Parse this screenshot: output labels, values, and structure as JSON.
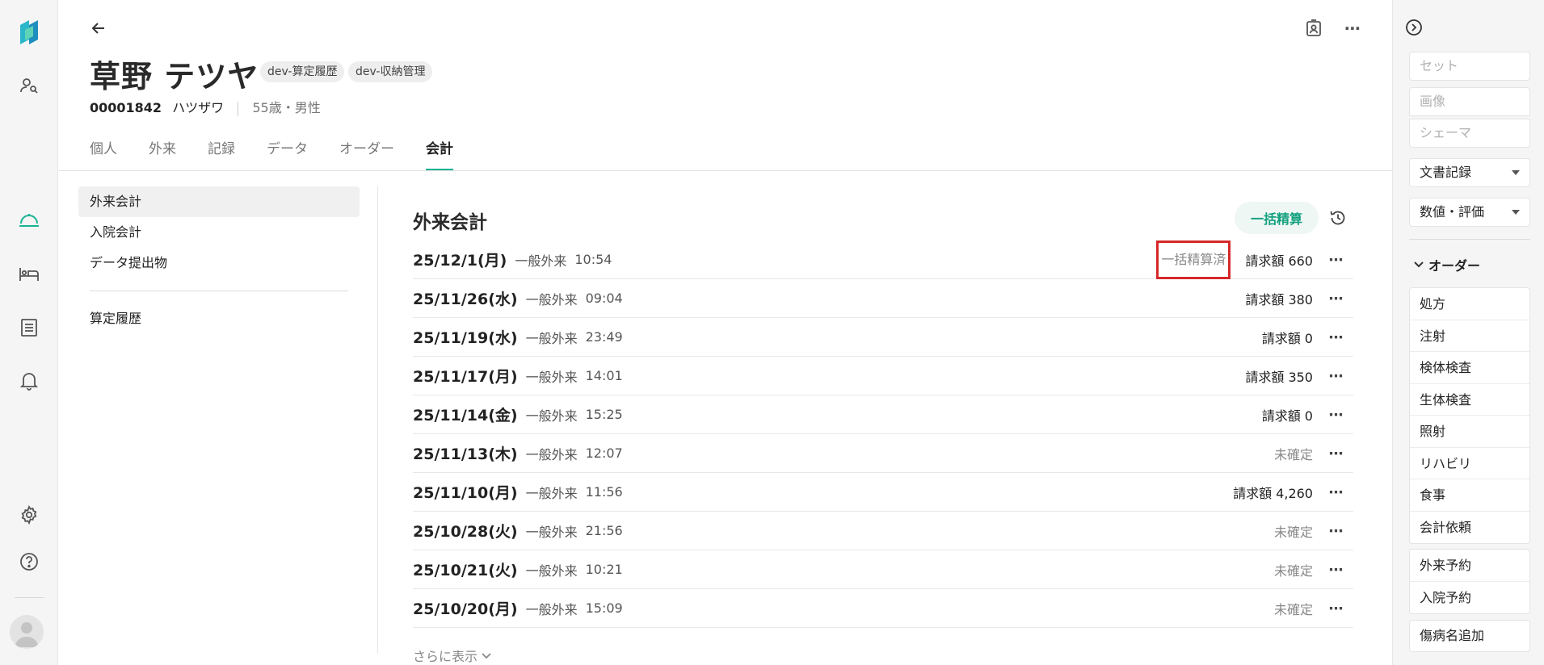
{
  "patient": {
    "name": "草野 テツヤ",
    "tags": [
      "dev-算定履歴",
      "dev-収納管理"
    ],
    "id": "00001842",
    "kana": "ハツザワ",
    "age_sex": "55歳・男性"
  },
  "tabs": [
    "個人",
    "外来",
    "記録",
    "データ",
    "オーダー",
    "会計"
  ],
  "active_tab": "会計",
  "subnav": {
    "items": [
      "外来会計",
      "入院会計",
      "データ提出物"
    ],
    "extra": "算定履歴"
  },
  "section": {
    "title": "外来会計",
    "bulk_button": "一括精算",
    "show_more": "さらに表示"
  },
  "visits": [
    {
      "date": "25/12/1(月)",
      "type": "一般外来",
      "time": "10:54",
      "status": "一括精算済",
      "amount": "請求額 660"
    },
    {
      "date": "25/11/26(水)",
      "type": "一般外来",
      "time": "09:04",
      "status": "",
      "amount": "請求額 380"
    },
    {
      "date": "25/11/19(水)",
      "type": "一般外来",
      "time": "23:49",
      "status": "",
      "amount": "請求額 0"
    },
    {
      "date": "25/11/17(月)",
      "type": "一般外来",
      "time": "14:01",
      "status": "",
      "amount": "請求額 350"
    },
    {
      "date": "25/11/14(金)",
      "type": "一般外来",
      "time": "15:25",
      "status": "",
      "amount": "請求額 0"
    },
    {
      "date": "25/11/13(木)",
      "type": "一般外来",
      "time": "12:07",
      "status": "",
      "amount": "未確定"
    },
    {
      "date": "25/11/10(月)",
      "type": "一般外来",
      "time": "11:56",
      "status": "",
      "amount": "請求額 4,260"
    },
    {
      "date": "25/10/28(火)",
      "type": "一般外来",
      "time": "21:56",
      "status": "",
      "amount": "未確定"
    },
    {
      "date": "25/10/21(火)",
      "type": "一般外来",
      "time": "10:21",
      "status": "",
      "amount": "未確定"
    },
    {
      "date": "25/10/20(月)",
      "type": "一般外来",
      "time": "15:09",
      "status": "",
      "amount": "未確定"
    }
  ],
  "right_panel": {
    "set": "セット",
    "image": "画像",
    "schema": "シェーマ",
    "doc_record": "文書記録",
    "numeric_eval": "数値・評価",
    "order_title": "オーダー",
    "orders": [
      "処方",
      "注射",
      "検体検査",
      "生体検査",
      "照射",
      "リハビリ",
      "食事",
      "会計依頼"
    ],
    "reservations": [
      "外来予約",
      "入院予約"
    ],
    "add_disease": "傷病名追加"
  },
  "colors": {
    "accent": "#1ab394",
    "highlight": "#d62828"
  }
}
